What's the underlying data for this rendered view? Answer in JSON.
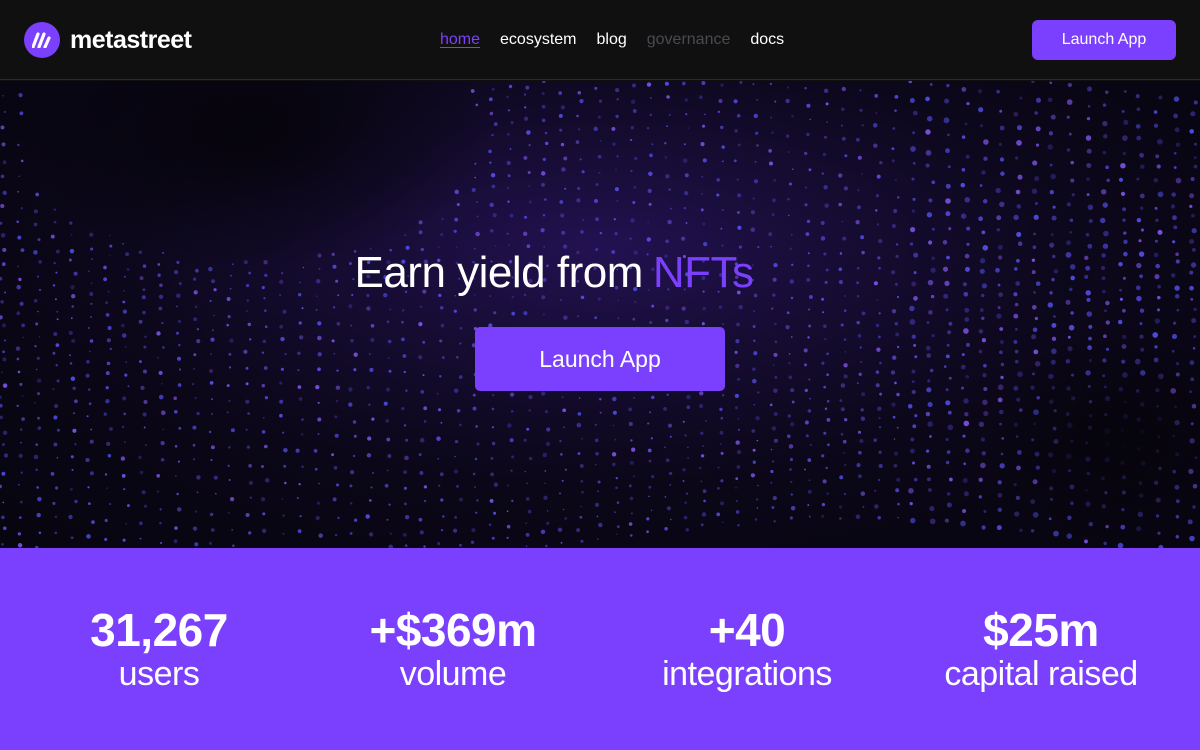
{
  "header": {
    "brand": "metastreet",
    "nav": [
      {
        "label": "home",
        "state": "active"
      },
      {
        "label": "ecosystem",
        "state": "normal"
      },
      {
        "label": "blog",
        "state": "normal"
      },
      {
        "label": "governance",
        "state": "disabled"
      },
      {
        "label": "docs",
        "state": "normal"
      }
    ],
    "launch_label": "Launch App"
  },
  "hero": {
    "title_prefix": "Earn yield from",
    "title_accent": "NFTs",
    "launch_label": "Launch App"
  },
  "stats": [
    {
      "value": "31,267",
      "label": "users"
    },
    {
      "value": "+$369m",
      "label": "volume"
    },
    {
      "value": "+40",
      "label": "integrations"
    },
    {
      "value": "$25m",
      "label": "capital raised"
    }
  ],
  "colors": {
    "accent": "#7b3ffe",
    "header_bg": "#101011",
    "hero_bg": "#0b0718",
    "disabled_text": "#4a4a50"
  },
  "icons": {
    "logo": "metastreet-logo-icon"
  }
}
